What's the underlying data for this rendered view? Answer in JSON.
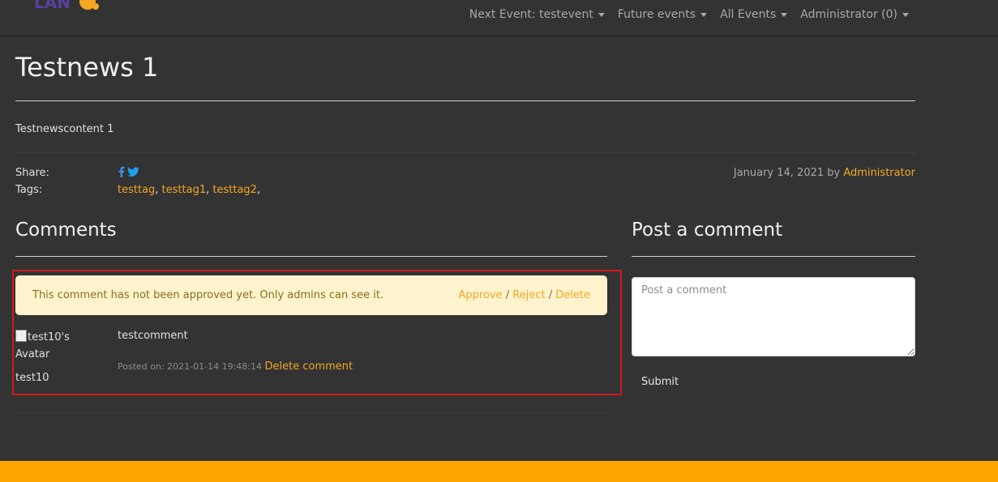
{
  "nav": {
    "items": [
      {
        "label": "Next Event: testevent"
      },
      {
        "label": "Future events"
      },
      {
        "label": "All Events"
      },
      {
        "label": "Administrator (0)"
      }
    ]
  },
  "article": {
    "title": "Testnews 1",
    "content": "Testnewscontent 1",
    "share_label": "Share:",
    "tags_label": "Tags:",
    "tags": [
      "testtag",
      "testtag1",
      "testtag2"
    ],
    "tag_separator": ", ",
    "tag_trailing": ",",
    "date": "January 14, 2021",
    "by_label": "by",
    "author": "Administrator"
  },
  "comments": {
    "heading": "Comments",
    "alert_text": "This comment has not been approved yet. Only admins can see it.",
    "approve_label": "Approve",
    "reject_label": "Reject",
    "delete_label": "Delete",
    "action_separator": "/",
    "avatar_alt": "test10's Avatar",
    "commenter": "test10",
    "text": "testcomment",
    "posted_on": "Posted on: 2021-01-14 19:48:14",
    "delete_comment_label": "Delete comment"
  },
  "post_comment": {
    "heading": "Post a comment",
    "placeholder": "Post a comment",
    "submit_label": "Submit"
  },
  "colors": {
    "background": "#333333",
    "accent": "#f5a623",
    "footer": "#ffa500",
    "alert_bg": "#fff3cd",
    "highlight": "#d11a1a",
    "facebook": "#3b8fe6",
    "twitter": "#1da1f2"
  },
  "icons": [
    "facebook-icon",
    "twitter-icon",
    "chevron-down-icon"
  ]
}
